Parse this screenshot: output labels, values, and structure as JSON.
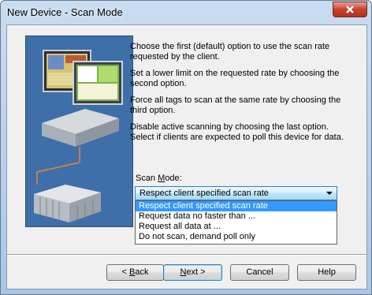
{
  "window": {
    "title": "New Device - Scan Mode"
  },
  "description": {
    "p1": "Choose the first (default) option to use the scan rate requested by the client.",
    "p2": "Set a lower limit on the requested rate by choosing the second option.",
    "p3": "Force all tags to scan at the same rate by choosing the third option.",
    "p4a": "Disable active scanning by choosing the last option.",
    "p4b": "Select if clients are expected to poll this device for data."
  },
  "scan_mode": {
    "label_pre": "Scan ",
    "label_accel": "M",
    "label_post": "ode:",
    "selected": "Respect client specified scan rate",
    "options": [
      "Respect client specified scan rate",
      "Request data no faster than ...",
      "Request all data at ...",
      "Do not scan, demand poll only"
    ]
  },
  "buttons": {
    "back_accel": "B",
    "back_rest": "ack",
    "back_prefix": "< ",
    "next_accel": "N",
    "next_rest": "ext >",
    "cancel": "Cancel",
    "help": "Help"
  },
  "colors": {
    "accent": "#3399ff",
    "close": "#c7412c",
    "art_bg": "#3f6fa9"
  },
  "icons": {
    "close": "close-icon",
    "illustration": "computer-plc-illustration"
  }
}
